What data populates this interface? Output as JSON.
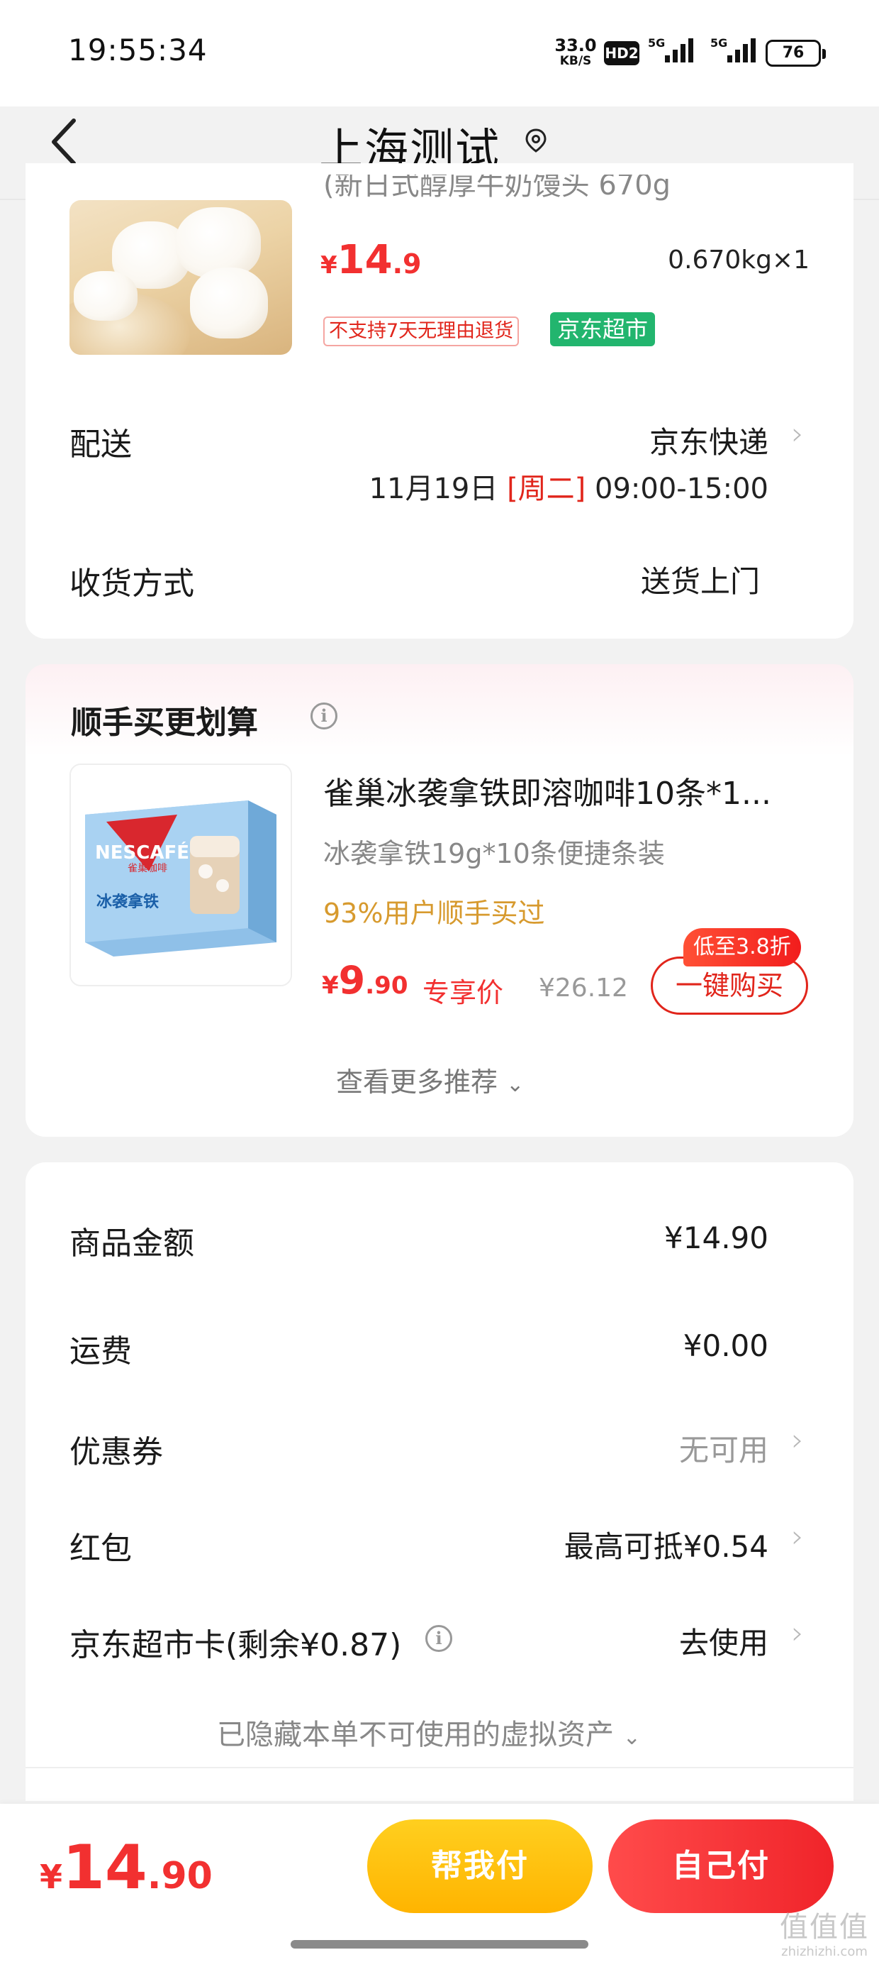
{
  "status_bar": {
    "time": "19:55:34",
    "net_speed_value": "33.0",
    "net_speed_unit": "KB/S",
    "hd_label": "HD2",
    "signal_1_label": "5G",
    "signal_2_label": "5G",
    "battery": "76"
  },
  "header": {
    "title": "上海测试",
    "back_icon": "chevron-left-icon",
    "location_icon": "location-pin-icon"
  },
  "product": {
    "title_partial": "(新日式醇厚牛奶馒头 670g",
    "price_yen": "¥",
    "price_int": "14",
    "price_dec": ".9",
    "weight_qty": "0.670kg×1",
    "tag_no_return": "不支持7天无理由退货",
    "tag_store": "京东超市"
  },
  "delivery": {
    "label": "配送",
    "carrier": "京东快递",
    "date": "11月19日",
    "weekday": "[周二]",
    "time_window": "09:00-15:00"
  },
  "receive": {
    "label": "收货方式",
    "value": "送货上门"
  },
  "recommend": {
    "title": "顺手买更划算",
    "name": "雀巢冰袭拿铁即溶咖啡10条*1...",
    "spec": "冰袭拿铁19g*10条便捷条装",
    "users": "93%用户顺手买过",
    "price_yen": "¥",
    "price_int": "9",
    "price_dec": ".90",
    "exclusive_label": "专享价",
    "original_price": "¥26.12",
    "buy_button": "一键购买",
    "discount_badge": "低至3.8折",
    "more_label": "查看更多推荐",
    "image_brand": "NESCAFÉ",
    "image_brand_cn": "雀巢咖啡",
    "image_product": "冰袭拿铁"
  },
  "summary": {
    "goods_amount_label": "商品金额",
    "goods_amount": "¥14.90",
    "shipping_label": "运费",
    "shipping": "¥0.00",
    "coupon_label": "优惠券",
    "coupon_value": "无可用",
    "redpacket_label": "红包",
    "redpacket_value": "最高可抵¥0.54",
    "card_label": "京东超市卡(剩余¥0.87)",
    "card_value": "去使用",
    "hidden_assets": "已隐藏本单不可使用的虚拟资产"
  },
  "bottom": {
    "total_yen": "¥",
    "total_int": "14",
    "total_dec": ".90",
    "help_pay": "帮我付",
    "self_pay": "自己付"
  },
  "watermark": {
    "glyphs": "值值值",
    "text": "zhizhizhi.com"
  }
}
